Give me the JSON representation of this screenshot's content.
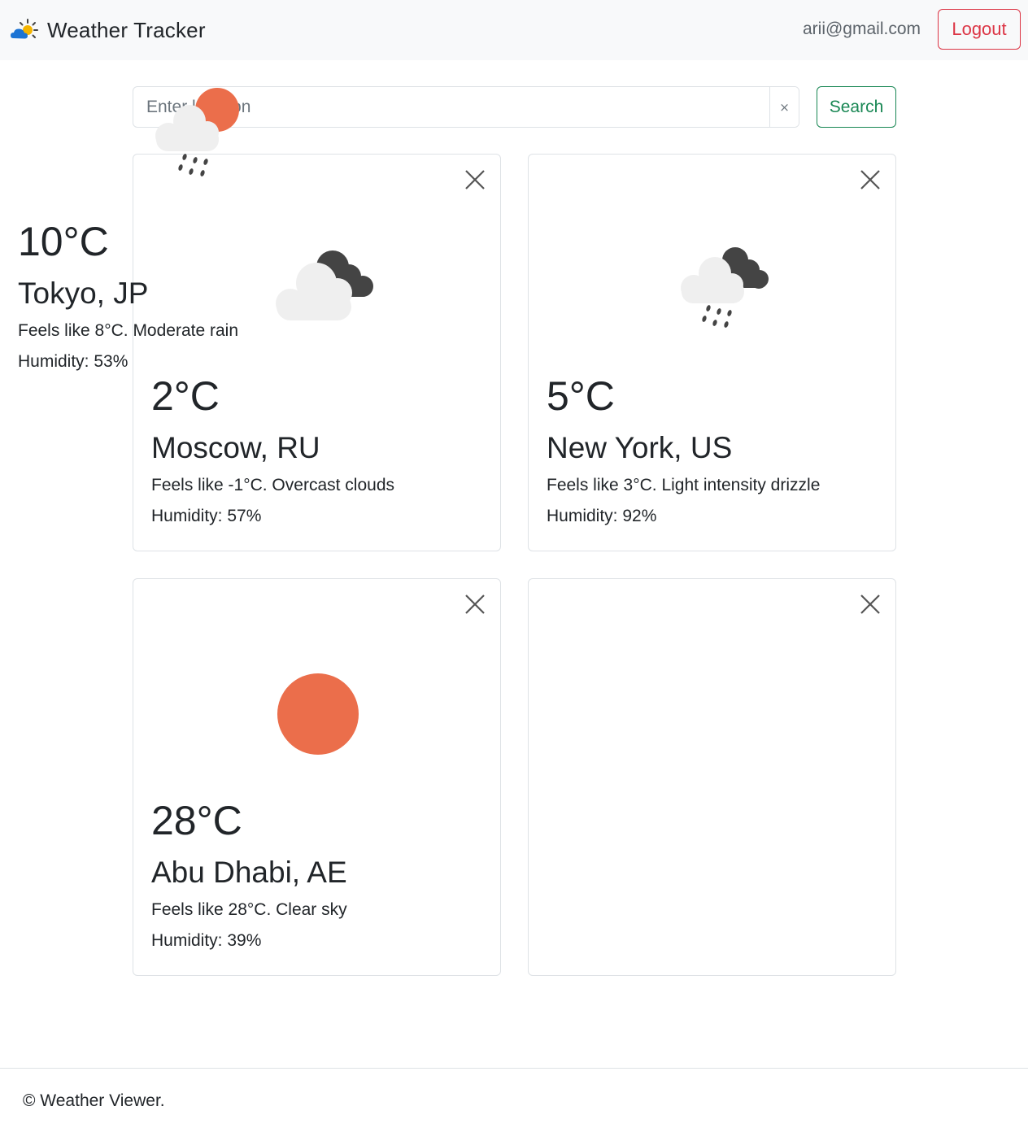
{
  "navbar": {
    "brand": "Weather Tracker",
    "user_email": "arii@gmail.com",
    "logout_label": "Logout"
  },
  "search": {
    "placeholder": "Enter location",
    "value": "",
    "clear_label": "×",
    "button_label": "Search"
  },
  "cards": [
    {
      "temp": "2°C",
      "city": "Moscow, RU",
      "description": "Feels like -1°C. Overcast clouds",
      "humidity": "Humidity: 57%",
      "icon": "overcast-clouds-icon"
    },
    {
      "temp": "5°C",
      "city": "New York, US",
      "description": "Feels like 3°C. Light intensity drizzle",
      "humidity": "Humidity: 92%",
      "icon": "drizzle-icon"
    },
    {
      "temp": "28°C",
      "city": "Abu Dhabi, AE",
      "description": "Feels like 28°C. Clear sky",
      "humidity": "Humidity: 39%",
      "icon": "sun-icon"
    },
    {
      "temp": "10°C",
      "city": "Tokyo, JP",
      "description": "Feels like 8°C. Moderate rain",
      "humidity": "Humidity: 53%",
      "icon": "sun-rain-icon"
    }
  ],
  "footer": {
    "text": "© Weather Viewer."
  },
  "colors": {
    "accent_danger": "#dc3545",
    "accent_success": "#198754",
    "sun": "#eb6e4b",
    "cloud_light": "#efefef",
    "cloud_dark": "#444444"
  }
}
